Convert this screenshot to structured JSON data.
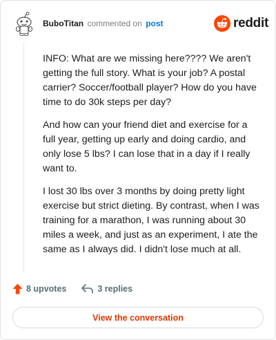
{
  "comment": {
    "author": "BuboTitan",
    "action_text": "commented on",
    "post_link": "post",
    "paragraphs": [
      "INFO: What are we missing here???? We aren't getting the full story. What is your job? A postal carrier? Soccer/football player? How do you have time to do 30k steps per day?",
      "And how can your friend diet and exercise for a full year, getting up early and doing cardio, and only lose 5 lbs? I can lose that in a day if I really want to.",
      "I lost 30 lbs over 3 months by doing pretty light exercise but strict dieting. By contrast, when I was training for a marathon, I was running about 30 miles a week, and just as an experiment, I ate the same as I always did. I didn't lose much at all."
    ]
  },
  "brand": {
    "wordmark": "reddit",
    "logo_icon": "reddit-snoo-icon",
    "accent_color": "#ff4500"
  },
  "actions": {
    "upvotes_label": "8 upvotes",
    "upvote_icon": "upvote-arrow-icon",
    "upvote_color": "#ff4500",
    "replies_label": "3 replies",
    "reply_icon": "reply-arrow-icon"
  },
  "cta": {
    "label": "View the conversation",
    "color": "#d93a00"
  }
}
